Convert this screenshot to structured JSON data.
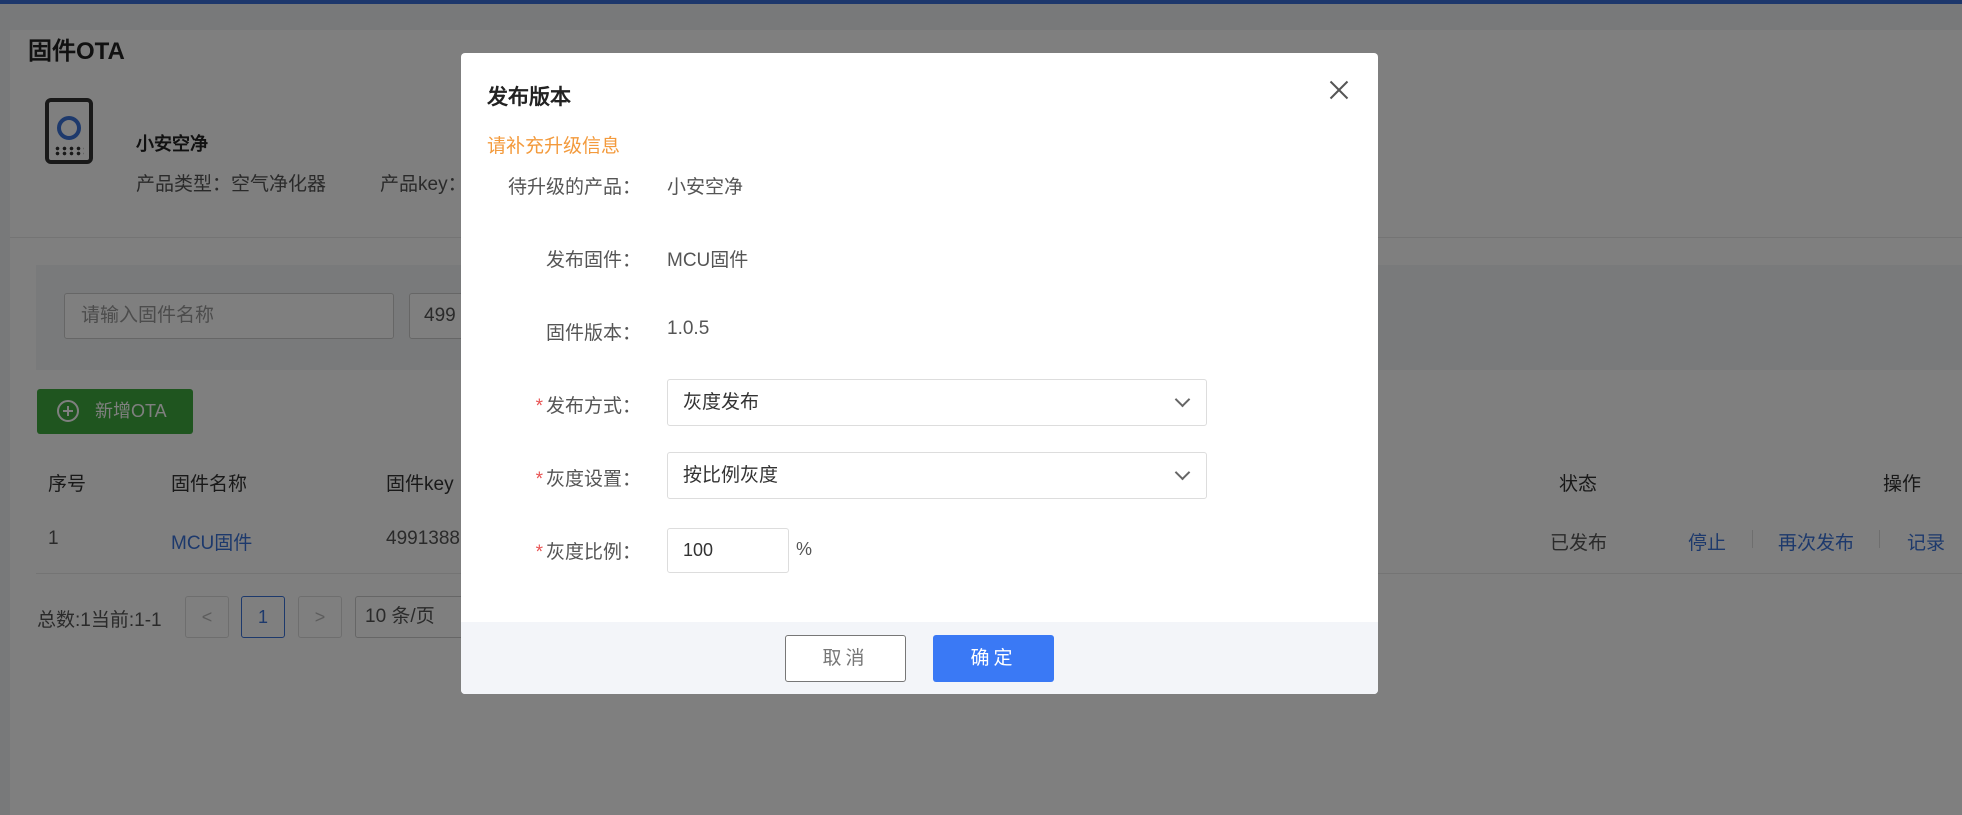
{
  "page": {
    "title": "固件OTA",
    "product": {
      "name": "小安空净",
      "type_label": "产品类型：空气净化器",
      "key_label": "产品key："
    },
    "filters": {
      "firmware_name_placeholder": "请输入固件名称",
      "key_value_partial": "499"
    },
    "add_button_label": "新增OTA",
    "table": {
      "headers": [
        "序号",
        "固件名称",
        "固件key",
        "状态",
        "操作"
      ],
      "rows": [
        {
          "index": "1",
          "name": "MCU固件",
          "key": "4991388",
          "status": "已发布",
          "actions": [
            "停止",
            "再次发布",
            "记录"
          ]
        }
      ]
    },
    "pagination": {
      "summary": "总数:1当前:1-1",
      "prev": "<",
      "current": "1",
      "next": ">",
      "page_size": "10 条/页"
    }
  },
  "modal": {
    "title": "发布版本",
    "notice": "请补充升级信息",
    "fields": {
      "product": {
        "label": "待升级的产品：",
        "value": "小安空净"
      },
      "firmware": {
        "label": "发布固件：",
        "value": "MCU固件"
      },
      "version": {
        "label": "固件版本：",
        "value": "1.0.5"
      },
      "method": {
        "required": "*",
        "label": "发布方式：",
        "value": "灰度发布"
      },
      "gray_setting": {
        "required": "*",
        "label": "灰度设置：",
        "value": "按比例灰度"
      },
      "gray_ratio": {
        "required": "*",
        "label": "灰度比例：",
        "value": "100",
        "unit": "%"
      }
    },
    "cancel_label": "取消",
    "confirm_label": "确定"
  },
  "colors": {
    "accent_blue": "#3a79f5",
    "link_blue": "#3a73d9",
    "add_green": "#3eab3e",
    "notice_orange": "#f39a3c",
    "required_red": "#e85454"
  },
  "icons": [
    "device-icon",
    "plus-circle-icon",
    "close-icon",
    "chevron-down-icon"
  ]
}
